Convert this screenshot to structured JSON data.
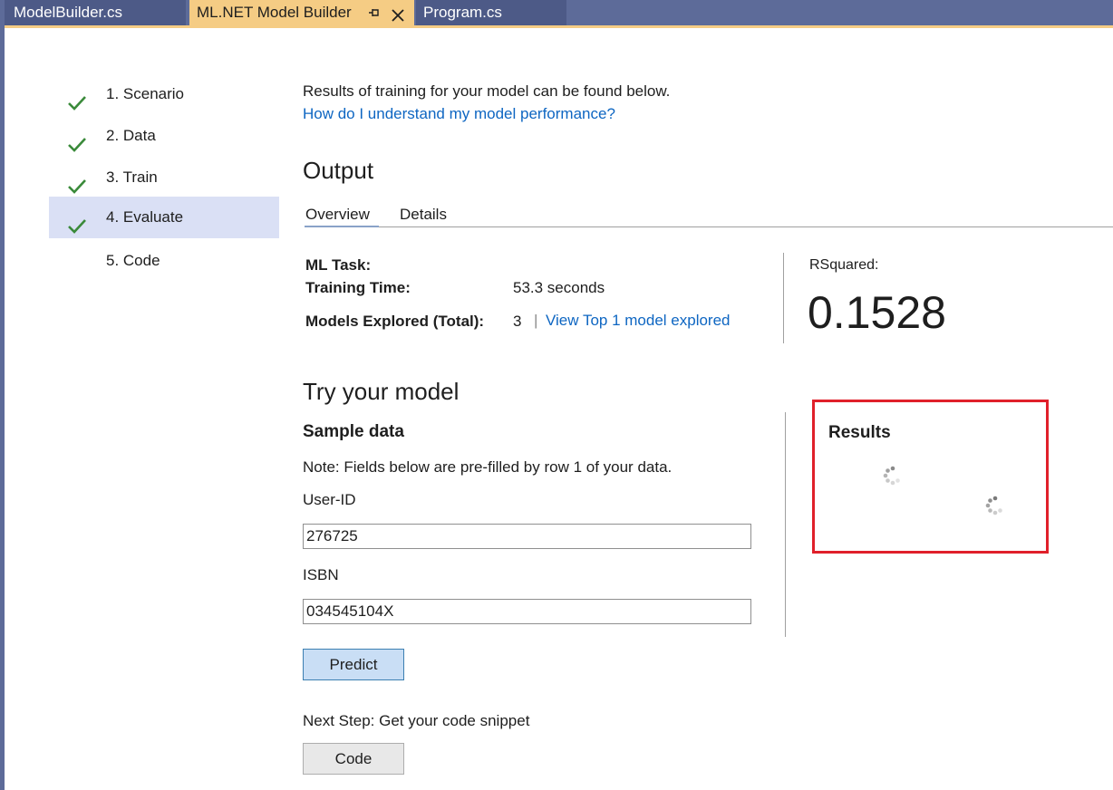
{
  "tabs": [
    {
      "label": "ModelBuilder.cs",
      "active": false
    },
    {
      "label": "ML.NET Model Builder",
      "active": true
    },
    {
      "label": "Program.cs",
      "active": false
    }
  ],
  "steps": [
    {
      "label": "1. Scenario",
      "done": true
    },
    {
      "label": "2. Data",
      "done": true
    },
    {
      "label": "3. Train",
      "done": true
    },
    {
      "label": "4. Evaluate",
      "done": true,
      "active": true
    },
    {
      "label": "5. Code",
      "done": false
    }
  ],
  "intro": {
    "text": "Results of training for your model can be found below.",
    "help_link": "How do I understand my model performance?"
  },
  "output": {
    "heading": "Output",
    "tabs": [
      "Overview",
      "Details"
    ],
    "selected_tab": "Overview",
    "ml_task_label": "ML Task:",
    "ml_task_value": "",
    "training_time_label": "Training Time:",
    "training_time_value": "53.3 seconds",
    "models_explored_label": "Models Explored (Total):",
    "models_explored_value": "3",
    "separator": "|",
    "view_models_link": "View Top 1 model explored",
    "metric_label": "RSquared:",
    "metric_value": "0.1528"
  },
  "try_model": {
    "heading": "Try your model",
    "sample_heading": "Sample data",
    "note": "Note: Fields below are pre-filled by row 1 of your data.",
    "fields": [
      {
        "label": "User-ID",
        "value": "276725"
      },
      {
        "label": "ISBN",
        "value": "034545104X"
      }
    ],
    "predict_label": "Predict",
    "results_heading": "Results",
    "results_state": "loading"
  },
  "next_step": {
    "text": "Next Step: Get your code snippet",
    "button_label": "Code"
  },
  "colors": {
    "tabstrip": "#5d6b99",
    "active_tab": "#f5cc84",
    "check": "#3a8a3a",
    "link": "#0e66c2",
    "active_step_bg": "#dae0f5",
    "highlight_border": "#e0202a",
    "predict_bg": "#c9def5"
  },
  "icons": {
    "check": "check-icon",
    "pin": "pin-icon",
    "close": "close-icon",
    "spinner": "loading-spinner-icon"
  }
}
